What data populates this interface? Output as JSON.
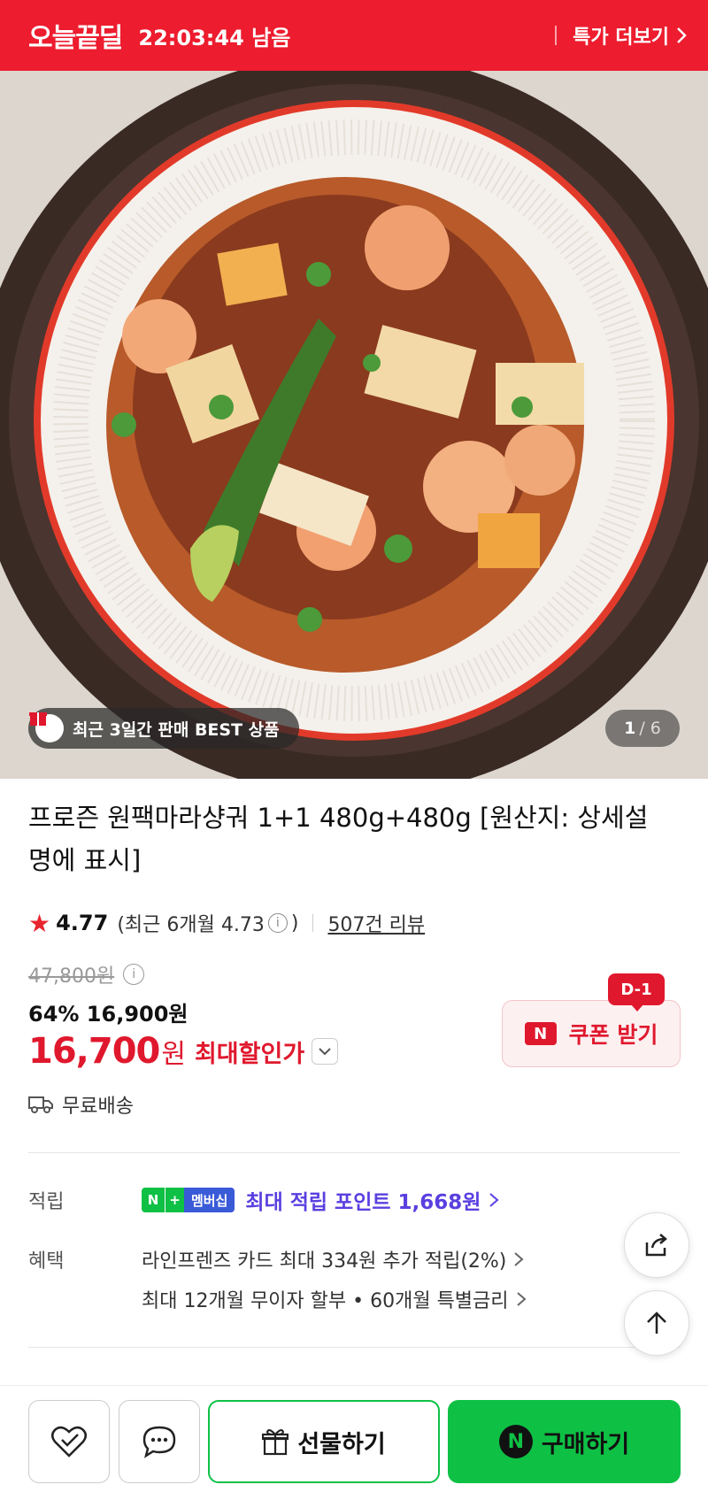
{
  "topbar": {
    "brand": "오늘끝딜",
    "timer": "22:03:44 남음",
    "more_label": "특가 더보기"
  },
  "hero": {
    "badge_text": "최근 3일간 판매 BEST 상품",
    "page_current": "1",
    "page_total": "/ 6"
  },
  "product": {
    "title": "프로즌 원팩마라샹궈 1+1 480g+480g [원산지: 상세설명에 표시]",
    "rating": "4.77",
    "recent_rating": "(최근 6개월 4.73",
    "recent_rating_close": ")",
    "reviews": "507건 리뷰",
    "original_price": "47,800원",
    "discount_price": "64% 16,900원",
    "final_amount": "16,700",
    "final_unit": "원",
    "final_label": "최대할인가",
    "shipping": "무료배송"
  },
  "coupon": {
    "dday": "D-1",
    "logo": "N",
    "label": "쿠폰 받기"
  },
  "points": {
    "label": "적립",
    "badge_n": "N",
    "badge_plus": "+",
    "badge_membership": "멤버십",
    "text": "최대 적립 포인트 1,668원"
  },
  "benefits": {
    "label": "혜택",
    "line1": "라인프렌즈 카드 최대 334원 추가 적립(2%)",
    "line2": "최대 12개월 무이자 할부 • 60개월 특별금리"
  },
  "bottom": {
    "gift_label": "선물하기",
    "buy_logo": "N",
    "buy_label": "구매하기"
  },
  "colors": {
    "brand_red": "#ed1c2e",
    "naver_green": "#0ec145",
    "point_purple": "#5a3fe0"
  }
}
